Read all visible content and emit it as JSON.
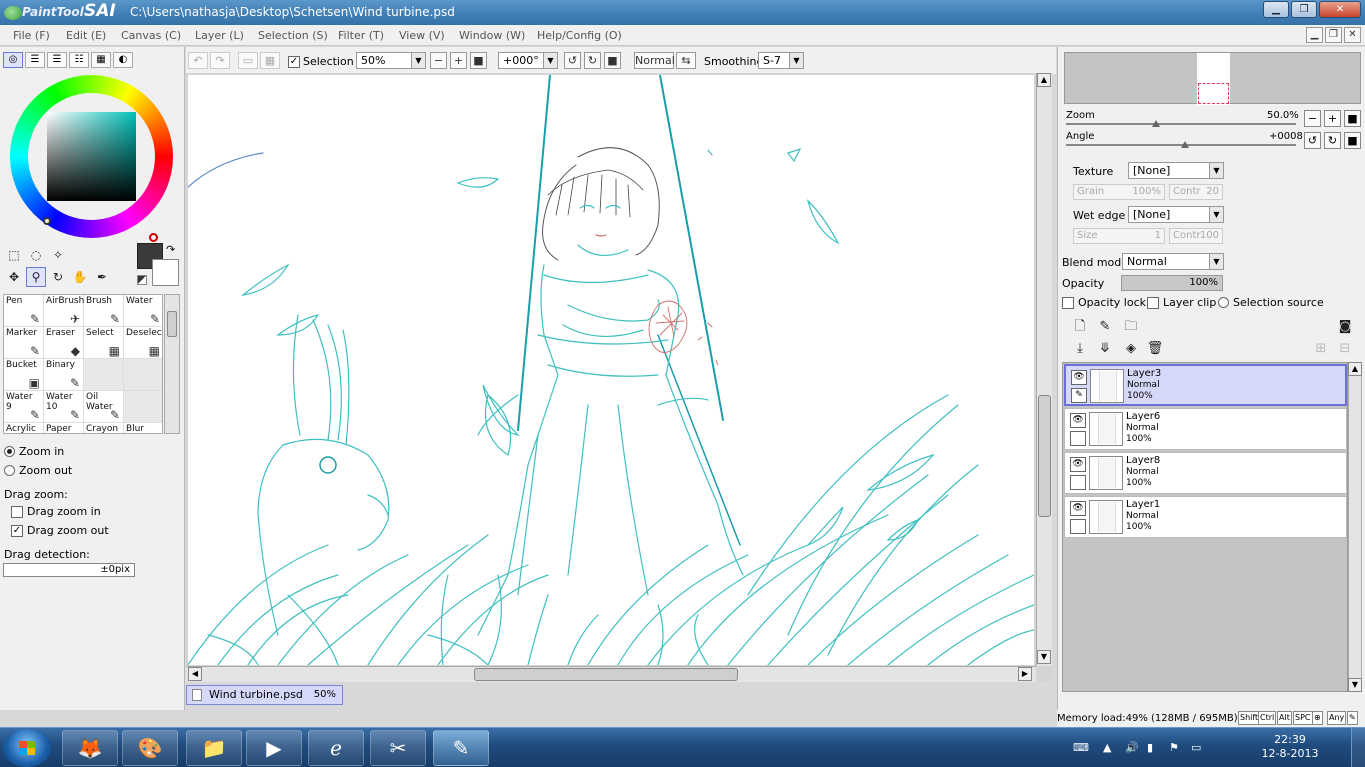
{
  "titlebar": {
    "app_name_prefix": "PaintTool",
    "app_name_suffix": "SAI",
    "path": "C:\\Users\\nathasja\\Desktop\\Schetsen\\Wind turbine.psd"
  },
  "menu": [
    "File (F)",
    "Edit (E)",
    "Canvas (C)",
    "Layer (L)",
    "Selection (S)",
    "Filter (T)",
    "View (V)",
    "Window (W)",
    "Help/Config (O)"
  ],
  "toolbar": {
    "selection_label": "Selection",
    "zoom_value": "50%",
    "angle_value": "+000°",
    "blend_value": "Normal",
    "smoothing_label": "Smoothing",
    "smoothing_value": "S-7"
  },
  "brushes": [
    {
      "name": "Pen",
      "icon": "✎"
    },
    {
      "name": "AirBrush",
      "icon": "✈"
    },
    {
      "name": "Brush",
      "icon": "✎"
    },
    {
      "name": "Water",
      "icon": "✎"
    },
    {
      "name": "Marker",
      "icon": "✎"
    },
    {
      "name": "Eraser",
      "icon": "◆"
    },
    {
      "name": "Select",
      "icon": "▦"
    },
    {
      "name": "Deselect",
      "icon": "▦"
    },
    {
      "name": "Bucket",
      "icon": "▣"
    },
    {
      "name": "Binary",
      "icon": "✎"
    },
    {
      "name": "",
      "icon": ""
    },
    {
      "name": "",
      "icon": ""
    },
    {
      "name": "Water\n9",
      "icon": "✎"
    },
    {
      "name": "Water\n10",
      "icon": "✎"
    },
    {
      "name": "Oil Water",
      "icon": "✎"
    },
    {
      "name": "",
      "icon": ""
    },
    {
      "name": "Acrylic",
      "icon": ""
    },
    {
      "name": "Paper",
      "icon": ""
    },
    {
      "name": "Crayon",
      "icon": ""
    },
    {
      "name": "Blur",
      "icon": ""
    }
  ],
  "zoom_options": {
    "zoom_in": "Zoom in",
    "zoom_out": "Zoom out",
    "drag_zoom_label": "Drag zoom:",
    "drag_zoom_in": "Drag zoom in",
    "drag_zoom_out": "Drag zoom out",
    "drag_detection_label": "Drag detection:",
    "drag_detection_value": "±0pix"
  },
  "document_tab": {
    "name": "Wind turbine.psd",
    "zoom": "50%"
  },
  "navigator": {
    "zoom_label": "Zoom",
    "zoom_value": "50.0%",
    "angle_label": "Angle",
    "angle_value": "+0008"
  },
  "brush_settings": {
    "texture_label": "Texture",
    "texture_value": "[None]",
    "grain_label": "Grain",
    "grain_value": "100%",
    "contr_label": "Contr",
    "contr_value_1": "20",
    "wet_edge_label": "Wet edge",
    "wet_edge_value": "[None]",
    "size_label": "Size",
    "size_value": "1",
    "contr_value_2": "100"
  },
  "layer_settings": {
    "blend_mode_label": "Blend mode",
    "blend_mode_value": "Normal",
    "opacity_label": "Opacity",
    "opacity_value": "100%",
    "opacity_lock": "Opacity lock",
    "layer_clip": "Layer clip",
    "selection_source": "Selection source"
  },
  "layers": [
    {
      "name": "Layer3",
      "mode": "Normal",
      "opacity": "100%",
      "selected": true
    },
    {
      "name": "Layer6",
      "mode": "Normal",
      "opacity": "100%",
      "selected": false
    },
    {
      "name": "Layer8",
      "mode": "Normal",
      "opacity": "100%",
      "selected": false
    },
    {
      "name": "Layer1",
      "mode": "Normal",
      "opacity": "100%",
      "selected": false
    }
  ],
  "status": {
    "memory": "Memory load:49% (128MB / 695MB)",
    "keys": [
      "Shift",
      "Ctrl",
      "Alt",
      "SPC",
      "⊕",
      "Any",
      "✎"
    ]
  },
  "taskbar": {
    "time": "22:39",
    "date": "12-8-2013"
  },
  "colors": {
    "line_teal": "#3fbfbf",
    "line_dark_teal": "#1a9ea8",
    "flower_red": "#d07070",
    "selection_blue": "#6b70d8"
  }
}
